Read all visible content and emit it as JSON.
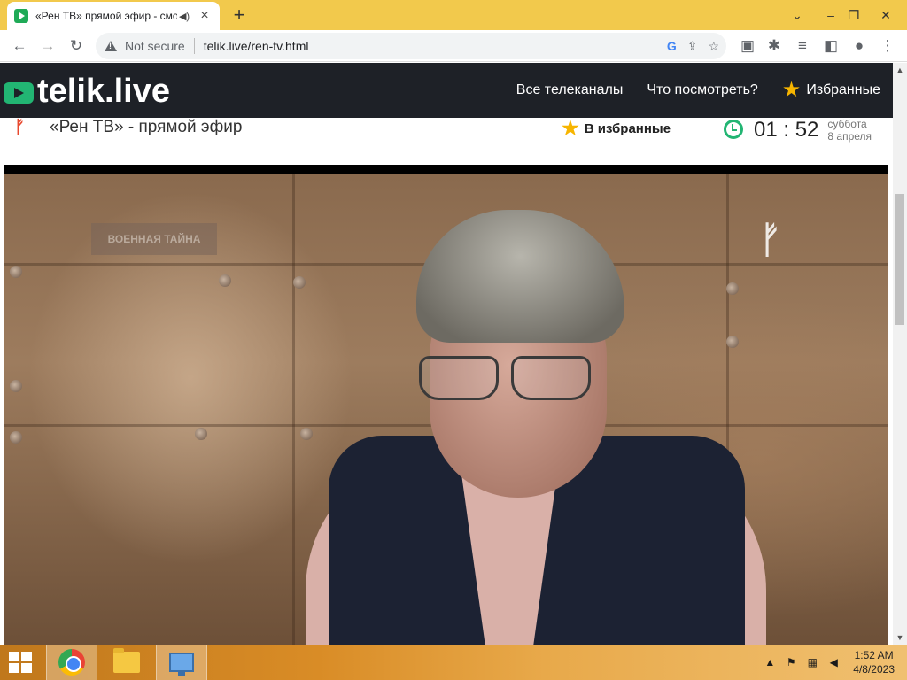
{
  "browser": {
    "tab_title": "«Рен ТВ» прямой эфир - смотреть онлайн",
    "security_label": "Not secure",
    "url": "telik.live/ren-tv.html"
  },
  "site": {
    "logo": "telik.live",
    "nav": {
      "all_channels": "Все телеканалы",
      "what_to_watch": "Что посмотреть?",
      "favorites": "Избранные"
    },
    "page_title": "«Рен ТВ» - прямой эфир",
    "add_favorite": "В избранные",
    "clock": {
      "time": "01 : 52",
      "weekday": "суббота",
      "date": "8 апреля"
    }
  },
  "video": {
    "overlay_text": "ВОЕННАЯ ТАЙНА"
  },
  "taskbar": {
    "time": "1:52 AM",
    "date": "4/8/2023"
  },
  "colors": {
    "tab_strip": "#f2c94c",
    "site_header": "#1e2127",
    "brand_green": "#22b573",
    "star": "#f7b500",
    "channel_logo": "#e8492f"
  },
  "icons": [
    "play-favicon-icon",
    "audio-icon",
    "close-icon",
    "plus-icon",
    "chevron-down-icon",
    "minimize-icon",
    "restore-icon",
    "back-icon",
    "forward-icon",
    "reload-icon",
    "warning-icon",
    "google-icon",
    "share-icon",
    "bookmark-star-icon",
    "extension-icon",
    "puzzle-icon",
    "media-icon",
    "sidepanel-icon",
    "profile-icon",
    "menu-icon",
    "star-icon",
    "clock-icon",
    "windows-start-icon",
    "chrome-icon",
    "folder-icon",
    "monitor-icon"
  ]
}
